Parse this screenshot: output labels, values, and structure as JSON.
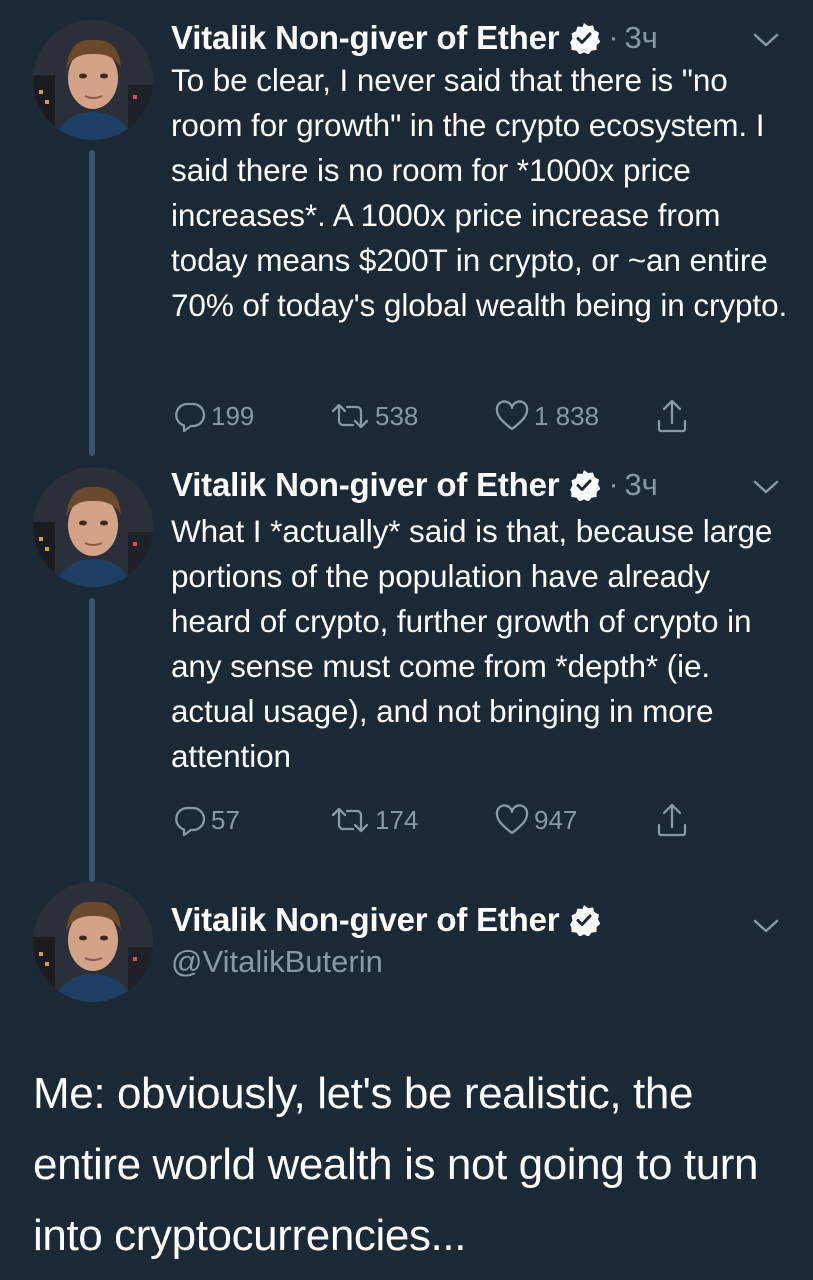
{
  "colors": {
    "background": "#1b2836",
    "text": "#ffffff",
    "muted": "#8899a6",
    "thread_line": "#3d5468"
  },
  "tweets": [
    {
      "name": "Vitalik Non-giver of Ether",
      "separator": "·",
      "time": "3ч",
      "text": "To be clear, I never said that there is \"no room for growth\" in the crypto ecosystem. I said there is no room for *1000x price increases*. A 1000x price increase from today means $200T in crypto, or ~an entire 70% of today's global wealth being in crypto.",
      "replies": "199",
      "retweets": "538",
      "likes": "1 838"
    },
    {
      "name": "Vitalik Non-giver of Ether",
      "separator": "·",
      "time": "3ч",
      "text": "What I *actually* said is that, because large portions of the population have already heard of crypto, further growth of crypto in any sense must come from *depth* (ie. actual usage), and not bringing in more attention",
      "replies": "57",
      "retweets": "174",
      "likes": "947"
    },
    {
      "name": "Vitalik Non-giver of Ether",
      "handle": "@VitalikButerin"
    }
  ],
  "meme_caption": "Me: obviously, let's be realistic, the entire world wealth is not going to turn into cryptocurrencies...",
  "icons": [
    "avatar",
    "verified-badge-icon",
    "chevron-down-icon",
    "reply-icon",
    "retweet-icon",
    "like-icon",
    "share-icon"
  ]
}
